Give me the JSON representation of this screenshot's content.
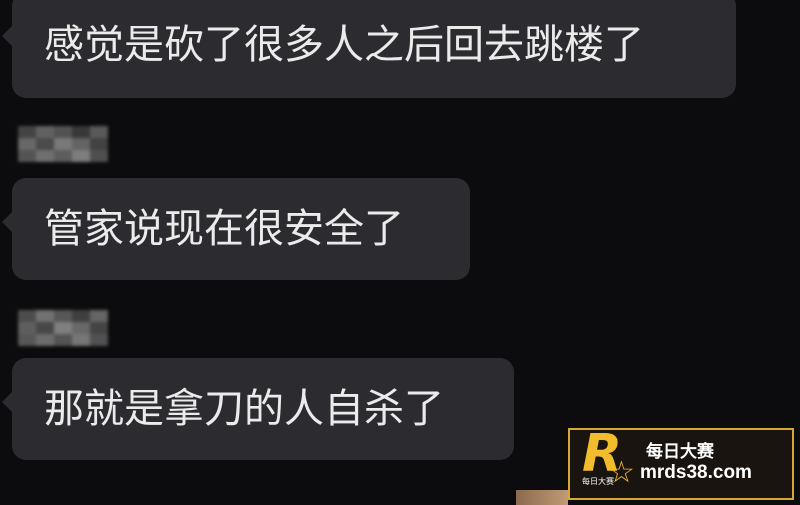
{
  "messages": [
    {
      "text": "感觉是砍了很多人之后回去跳楼了"
    },
    {
      "text": "管家说现在很安全了"
    },
    {
      "text": "那就是拿刀的人自杀了"
    }
  ],
  "watermark": {
    "logo_letter": "R",
    "logo_small_text": "每日大赛",
    "brand_name": "每日大赛",
    "url": "mrds38.com"
  },
  "colors": {
    "background": "#0c0b0d",
    "bubble": "#2c2b2f",
    "bubble_text": "#ebebeb",
    "watermark_gold": "#d7a733"
  },
  "icons": {
    "sender_name": "blurred-name-icon",
    "logo_star": "star-icon"
  }
}
